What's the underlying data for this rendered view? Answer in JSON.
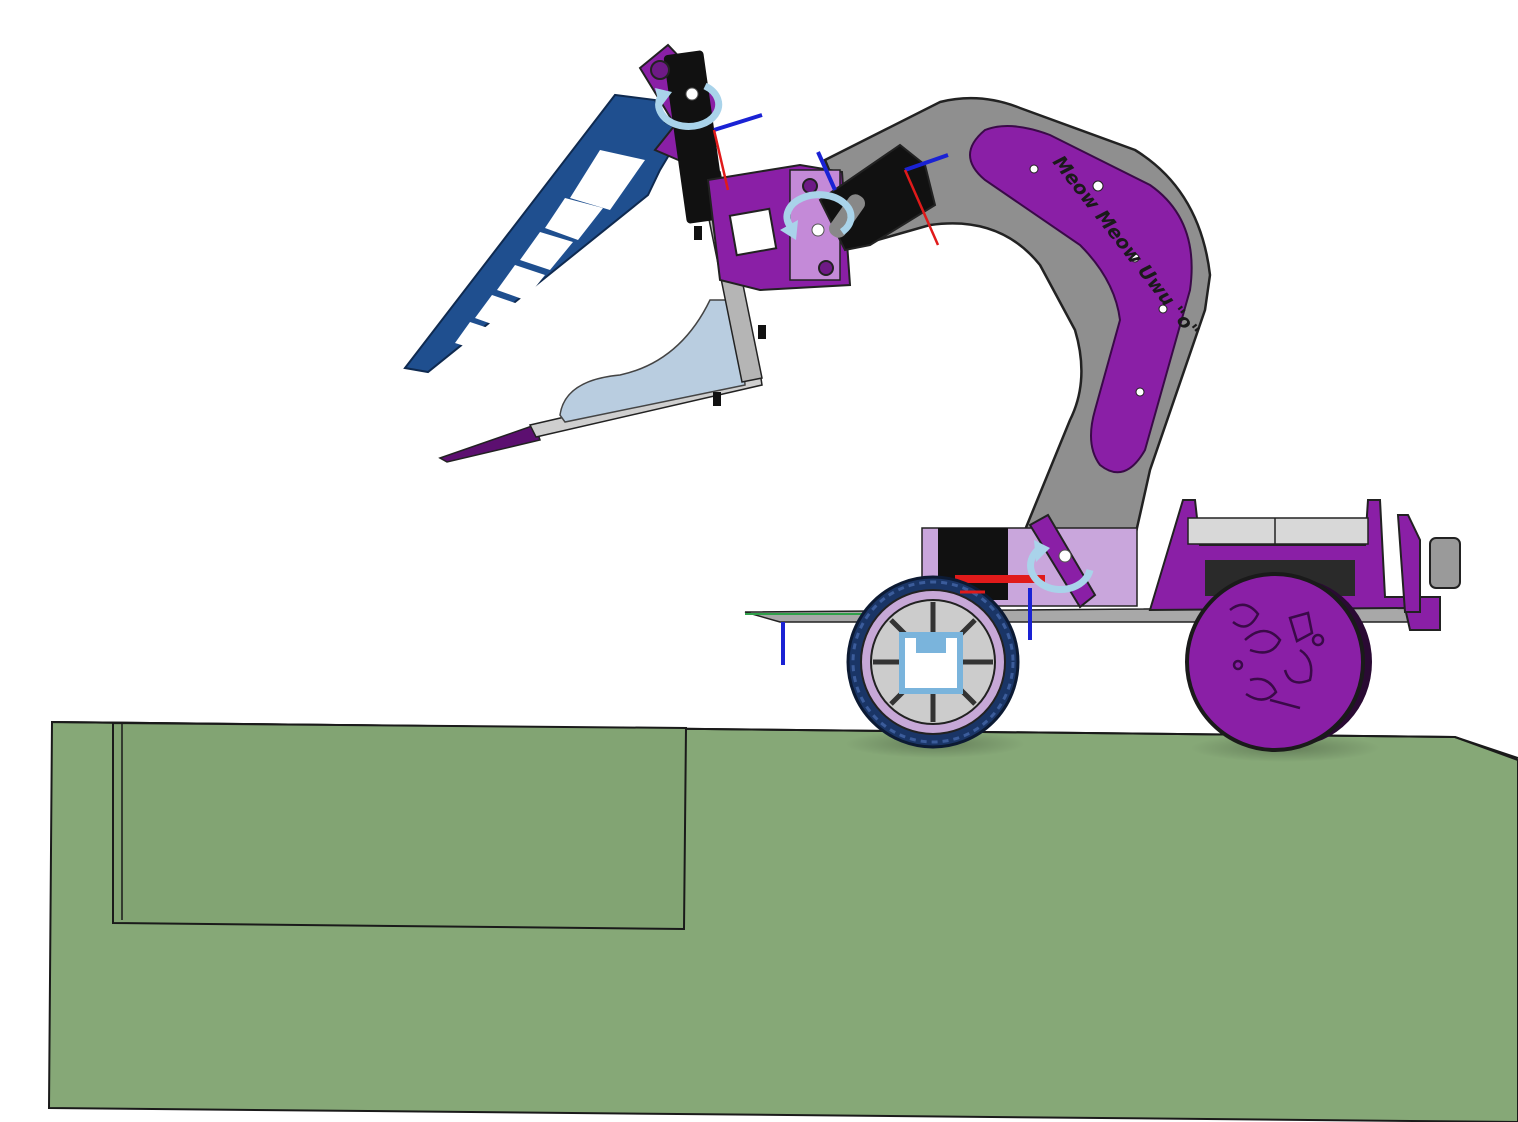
{
  "viewport": {
    "background": "#ffffff"
  },
  "colors": {
    "table_green": "#86a877",
    "table_green_dark": "#6f8f62",
    "robot_purple": "#8a1fa6",
    "robot_purple_dark": "#5c0f70",
    "light_purple": "#c9a6dc",
    "arm_gray": "#8f8f8f",
    "arm_gray_dark": "#6e6e6e",
    "gripper_blue": "#1f4f8f",
    "pale_blue": "#b9cde0",
    "axis_blue": "#1a22d4",
    "axis_red": "#e01a1a",
    "rotation_arrow": "#a9d3ea"
  },
  "arm_label": "Meow Meow Uwu \"o\"",
  "icons": {
    "rotation_joints": [
      "rotation-arrow-icon",
      "rotation-arrow-icon",
      "rotation-arrow-icon"
    ],
    "axis_triads": [
      "mate-connector-icon",
      "mate-connector-icon",
      "mate-connector-icon"
    ]
  }
}
